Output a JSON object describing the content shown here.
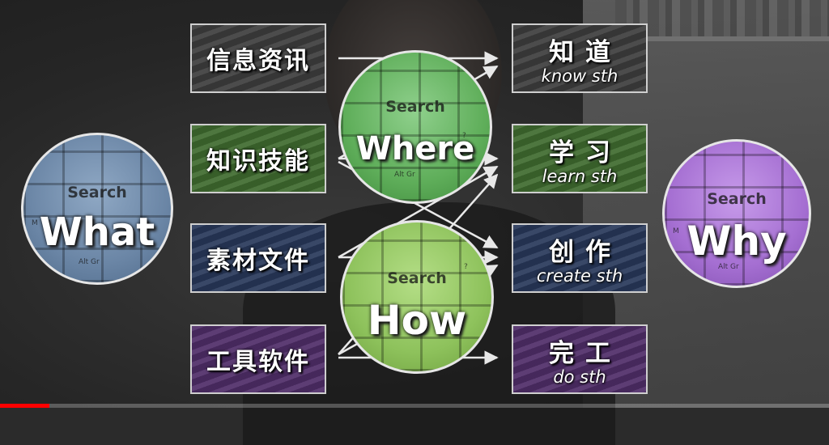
{
  "circles": {
    "what": {
      "word": "What",
      "key": "Search"
    },
    "where": {
      "word": "Where",
      "key": "Search"
    },
    "how": {
      "word": "How",
      "key": "Search"
    },
    "why": {
      "word": "Why",
      "key": "Search"
    }
  },
  "key_small": {
    "m": "M",
    "alt": "Alt Gr",
    "q": "?"
  },
  "inputs": [
    {
      "label": "信息资讯",
      "color": "#3d3d3d"
    },
    {
      "label": "知识技能",
      "color": "#3f6b2f"
    },
    {
      "label": "素材文件",
      "color": "#28385a"
    },
    {
      "label": "工具软件",
      "color": "#4f2d68"
    }
  ],
  "outputs": [
    {
      "zh": "知道",
      "en": "know sth",
      "color": "#3d3d3d"
    },
    {
      "zh": "学习",
      "en": "learn sth",
      "color": "#3f6b2f"
    },
    {
      "zh": "创作",
      "en": "create sth",
      "color": "#28385a"
    },
    {
      "zh": "完工",
      "en": "do sth",
      "color": "#4f2d68"
    }
  ],
  "video": {
    "progress_fraction": 0.06,
    "progress_color": "#ff0000"
  }
}
